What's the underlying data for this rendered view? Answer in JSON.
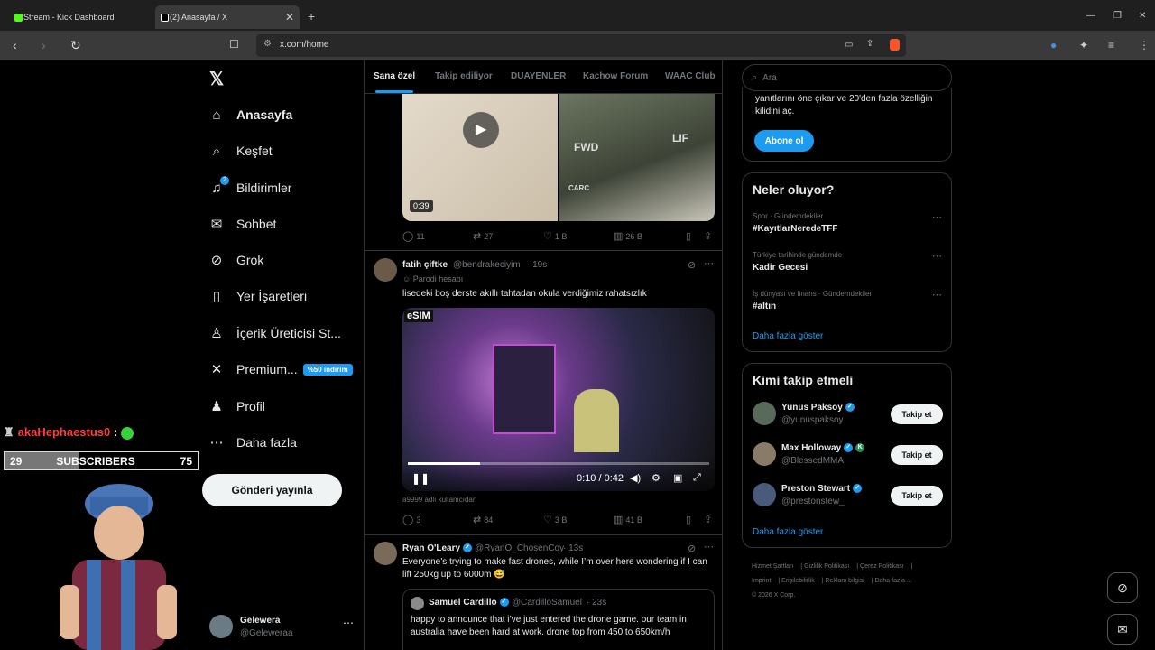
{
  "browser": {
    "tabs": [
      {
        "title": "Stream - Kick Dashboard",
        "favicon_color": "#53fc18"
      },
      {
        "title": "(2) Anasayfa / X",
        "favicon_color": "#ffffff"
      }
    ],
    "url": "x.com/home"
  },
  "nav": {
    "items": [
      {
        "label": "Anasayfa",
        "icon": "home-icon"
      },
      {
        "label": "Keşfet",
        "icon": "search-icon"
      },
      {
        "label": "Bildirimler",
        "icon": "bell-icon",
        "badge": "2"
      },
      {
        "label": "Sohbet",
        "icon": "mail-icon"
      },
      {
        "label": "Grok",
        "icon": "grok-icon"
      },
      {
        "label": "Yer İşaretleri",
        "icon": "bookmark-icon"
      },
      {
        "label": "İçerik Üreticisi St...",
        "icon": "creator-icon"
      },
      {
        "label": "Premium...",
        "icon": "x-icon",
        "badge": "%50 indirim"
      },
      {
        "label": "Profil",
        "icon": "person-icon"
      },
      {
        "label": "Daha fazla",
        "icon": "more-icon"
      }
    ],
    "post_label": "Gönderi yayınla",
    "account": {
      "name": "Gelewera",
      "handle": "@Geleweraa"
    }
  },
  "overlay": {
    "chat_user": "akaHephaestus0",
    "chat_sep": ":",
    "sub_current": "29",
    "sub_label": "SUBSCRIBERS",
    "sub_goal": "75",
    "sub_progress": 0.387
  },
  "feed": {
    "tabs": [
      "Sana özel",
      "Takip ediliyor",
      "DUAYENLER",
      "Kachow Forum",
      "WAAC Club"
    ],
    "tweet1": {
      "duration": "0:39",
      "crate_labels": [
        "FWD",
        "LIF",
        "CARC"
      ],
      "replies": "11",
      "reposts": "27",
      "likes": "1 B",
      "views": "26 B"
    },
    "tweet2": {
      "name": "fatih çiftke",
      "handle": "@bendrakeciyim",
      "time": "· 19s",
      "parody": "Parodi hesabı",
      "text": "lisedeki boş derste akıllı tahtadan okula verdiğimiz rahatsızlık",
      "video_badge": "eSIM",
      "video_time": "0:10 / 0:42",
      "video_progress": 0.24,
      "credit": "a9999 adlı kullanıcıdan",
      "replies": "3",
      "reposts": "84",
      "likes": "3 B",
      "views": "41 B"
    },
    "tweet3": {
      "name": "Ryan O'Leary",
      "handle": "@RyanO_ChosenCoy",
      "time": "· 13s",
      "text": "Everyone’s trying to make fast drones, while I’m over here wondering if I can lift 250kg up to 6000m 😅",
      "quote": {
        "name": "Samuel Cardillo",
        "handle": "@CardilloSamuel",
        "time": "· 23s",
        "text": "happy to announce that i’ve just entered the drone game. our team in australia have been hard at work. drone top from 450 to 650km/h"
      }
    }
  },
  "sidebar": {
    "search_placeholder": "Ara",
    "premium_text": "yanıtlarını öne çıkar ve 20'den fazla özelliğin kilidini aç.",
    "subscribe_label": "Abone ol",
    "trends_title": "Neler oluyor?",
    "trends": [
      {
        "category": "Spor · Gündemdekiler",
        "name": "#KayıtlarNeredeTFF"
      },
      {
        "category": "Türkiye tarihinde gündemde",
        "name": "Kadir Gecesi"
      },
      {
        "category": "İş dünyası ve finans · Gündemdekiler",
        "name": "#altın"
      }
    ],
    "show_more": "Daha fazla göster",
    "follow_title": "Kimi takip etmeli",
    "follow": [
      {
        "name": "Yunus Paksoy",
        "handle": "@yunuspaksoy"
      },
      {
        "name": "Max Holloway",
        "handle": "@BlessedMMA"
      },
      {
        "name": "Preston Stewart",
        "handle": "@prestonstew_"
      }
    ],
    "follow_label": "Takip et",
    "footer": [
      "Hizmet Şartları",
      "Gizlilik Politikası",
      "Çerez Politikası",
      "Imprint",
      "Erişilebilirlik",
      "Reklam bilgisi",
      "Daha fazla ...",
      "© 2026 X Corp."
    ]
  },
  "colors": {
    "accent": "#1d9bf0",
    "bg": "#000000",
    "border": "#2f3336",
    "muted": "#71767b"
  }
}
